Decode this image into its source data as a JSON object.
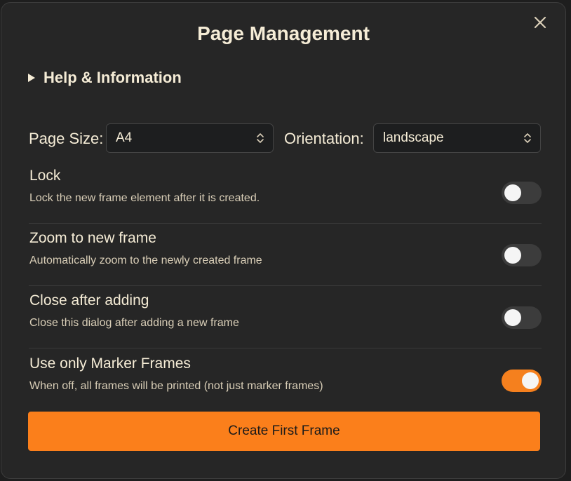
{
  "dialog": {
    "title": "Page Management",
    "close_icon": "close-icon"
  },
  "help": {
    "label": "Help & Information",
    "icon": "disclosure-triangle-icon"
  },
  "page_settings": {
    "page_size_label": "Page Size:",
    "page_size_value": "A4",
    "orientation_label": "Orientation:",
    "orientation_value": "landscape"
  },
  "settings": [
    {
      "title": "Lock",
      "description": "Lock the new frame element after it is created.",
      "enabled": false
    },
    {
      "title": "Zoom to new frame",
      "description": "Automatically zoom to the newly created frame",
      "enabled": false
    },
    {
      "title": "Close after adding",
      "description": "Close this dialog after adding a new frame",
      "enabled": false
    },
    {
      "title": "Use only Marker Frames",
      "description": "When off, all frames will be printed (not just marker frames)",
      "enabled": true
    }
  ],
  "actions": {
    "create_label": "Create First Frame"
  },
  "colors": {
    "accent": "#fb7f1b",
    "background": "#262626",
    "text": "#f5ecd6"
  }
}
